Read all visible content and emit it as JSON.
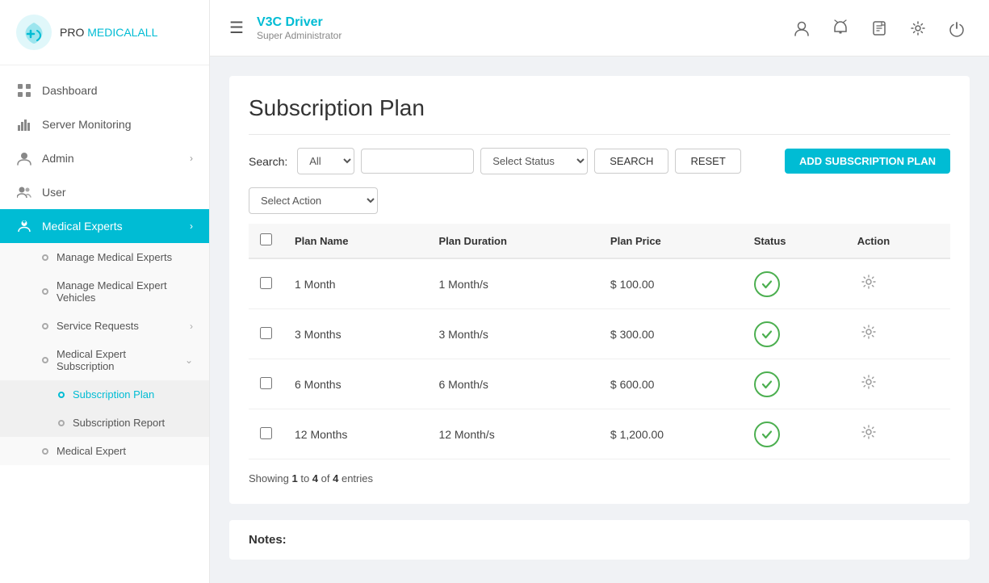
{
  "app": {
    "logo_pro": "PRO",
    "logo_medical": "MEDICALALL"
  },
  "sidebar": {
    "nav_items": [
      {
        "id": "dashboard",
        "label": "Dashboard",
        "icon": "grid",
        "active": false,
        "has_children": false
      },
      {
        "id": "server-monitoring",
        "label": "Server Monitoring",
        "icon": "bar-chart",
        "active": false,
        "has_children": false
      },
      {
        "id": "admin",
        "label": "Admin",
        "icon": "person",
        "active": false,
        "has_children": true
      },
      {
        "id": "user",
        "label": "User",
        "icon": "person-group",
        "active": false,
        "has_children": false
      },
      {
        "id": "medical-experts",
        "label": "Medical Experts",
        "icon": "person-badge",
        "active": true,
        "has_children": true
      }
    ],
    "sub_items": [
      {
        "id": "manage-experts",
        "label": "Manage Medical Experts",
        "active": false
      },
      {
        "id": "manage-vehicles",
        "label": "Manage Medical Expert Vehicles",
        "active": false
      },
      {
        "id": "service-requests",
        "label": "Service Requests",
        "active": false,
        "has_children": true
      },
      {
        "id": "expert-subscription",
        "label": "Medical Expert Subscription",
        "active": true,
        "has_children": true
      }
    ],
    "subscription_items": [
      {
        "id": "subscription-plan",
        "label": "Subscription Plan",
        "active": true
      },
      {
        "id": "subscription-report",
        "label": "Subscription Report",
        "active": false
      }
    ],
    "bottom_items": [
      {
        "id": "medical-expert",
        "label": "Medical Expert",
        "active": false
      }
    ]
  },
  "topbar": {
    "driver_name": "V3C Driver",
    "driver_role": "Super Administrator"
  },
  "page": {
    "title": "Subscription Plan",
    "search_label": "Search:",
    "search_options": [
      "All"
    ],
    "search_placeholder": "",
    "status_placeholder": "Select Status",
    "btn_search": "SEARCH",
    "btn_reset": "RESET",
    "btn_add": "ADD SUBSCRIPTION PLAN",
    "action_placeholder": "Select Action",
    "table": {
      "headers": [
        "Plan Name",
        "Plan Duration",
        "Plan Price",
        "Status",
        "Action"
      ],
      "rows": [
        {
          "id": 1,
          "plan_name": "1 Month",
          "plan_duration": "1 Month/s",
          "plan_price": "$ 100.00",
          "status": "active"
        },
        {
          "id": 2,
          "plan_name": "3 Months",
          "plan_duration": "3 Month/s",
          "plan_price": "$ 300.00",
          "status": "active"
        },
        {
          "id": 3,
          "plan_name": "6 Months",
          "plan_duration": "6 Month/s",
          "plan_price": "$ 600.00",
          "status": "active"
        },
        {
          "id": 4,
          "plan_name": "12 Months",
          "plan_duration": "12 Month/s",
          "plan_price": "$ 1,200.00",
          "status": "active"
        }
      ]
    },
    "showing_start": "1",
    "showing_end": "4",
    "showing_total": "4",
    "showing_text": "entries",
    "notes_label": "Notes:"
  }
}
